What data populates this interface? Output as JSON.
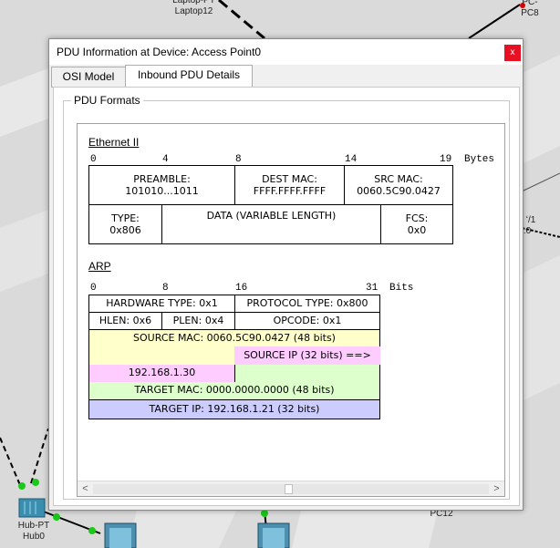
{
  "background": {
    "labels": {
      "laptop_type": "Laptop-PT",
      "laptop_name": "Laptop12",
      "pc_type": "PC-",
      "pc8": "PC8",
      "hub_type": "Hub-PT",
      "hub_name": "Hub0",
      "pc12": "PC12",
      "partial_a": "ʻ/1",
      "partial_b": ":0"
    }
  },
  "window": {
    "title": "PDU Information at Device: Access Point0",
    "close_label": "x",
    "tabs": [
      {
        "label": "OSI Model",
        "active": false
      },
      {
        "label": "Inbound PDU Details",
        "active": true
      }
    ],
    "group_label": "PDU Formats"
  },
  "ethernet": {
    "title": "Ethernet II",
    "ruler": [
      "0",
      "4",
      "8",
      "14",
      "19"
    ],
    "unit": "Bytes",
    "fields": {
      "preamble_name": "PREAMBLE:",
      "preamble_value": "101010...1011",
      "dest_mac_name": "DEST MAC:",
      "dest_mac_value": "FFFF.FFFF.FFFF",
      "src_mac_name": "SRC MAC:",
      "src_mac_value": "0060.5C90.0427",
      "type_name": "TYPE:",
      "type_value": "0x806",
      "data_name": "DATA (VARIABLE LENGTH)",
      "fcs_name": "FCS:",
      "fcs_value": "0x0"
    }
  },
  "arp": {
    "title": "ARP",
    "ruler": [
      "0",
      "8",
      "16",
      "31"
    ],
    "unit": "Bits",
    "fields": {
      "hardware_type": "HARDWARE TYPE: 0x1",
      "protocol_type": "PROTOCOL TYPE: 0x800",
      "hlen": "HLEN: 0x6",
      "plen": "PLEN: 0x4",
      "opcode": "OPCODE: 0x1",
      "source_mac": "SOURCE MAC: 0060.5C90.0427 (48 bits)",
      "source_ip_label": "SOURCE IP (32 bits) ==>",
      "source_ip_value": "192.168.1.30",
      "target_mac": "TARGET MAC: 0000.0000.0000 (48 bits)",
      "target_ip": "TARGET IP: 192.168.1.21 (32 bits)"
    },
    "colors": {
      "source_mac": "#ffffcc",
      "source_ip": "#ffccff",
      "target_mac": "#ddffcc",
      "target_ip": "#ccccff"
    }
  },
  "scrollbar": {
    "left_arrow": "<",
    "right_arrow": ">"
  }
}
